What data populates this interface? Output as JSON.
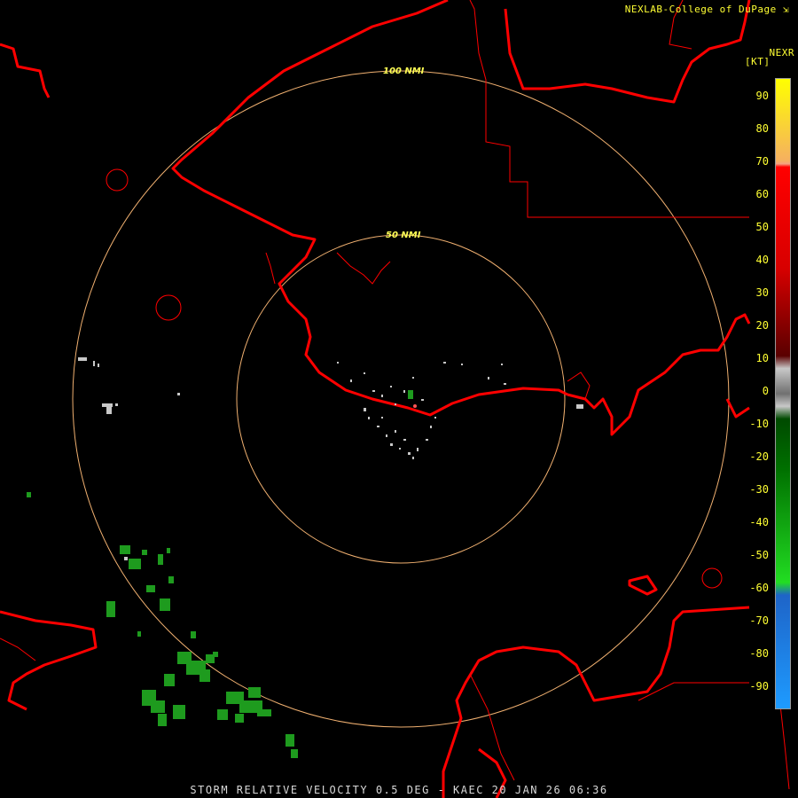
{
  "header": {
    "credit": "NEXLAB-College of DuPage",
    "credit_icon": "k-arrow-icon",
    "product": "NEXR",
    "units": "[KT]"
  },
  "footer": {
    "caption": "STORM RELATIVE VELOCITY 0.5 DEG - KAEC 20 JAN 26 06:36"
  },
  "range_rings": {
    "inner_label": "50 NMI",
    "outer_label": "100 NMI"
  },
  "legend": {
    "ticks": [
      "90",
      "80",
      "70",
      "60",
      "50",
      "40",
      "30",
      "20",
      "10",
      "0",
      "-10",
      "-20",
      "-30",
      "-40",
      "-50",
      "-60",
      "-70",
      "-80",
      "-90"
    ],
    "colors": {
      "top": "#ffff00",
      "orange": "#f5b060",
      "red": "#ff0000",
      "darkred": "#5a0000",
      "gray": "#c8c8c8",
      "darkgreen": "#006400",
      "green": "#22dd22",
      "blue": "#1e64c8",
      "lightblue": "#1e9bff"
    }
  },
  "colors": {
    "background": "#000000",
    "coastline": "#ff0000",
    "rings": "#f0b070",
    "text": "#ffff33"
  }
}
